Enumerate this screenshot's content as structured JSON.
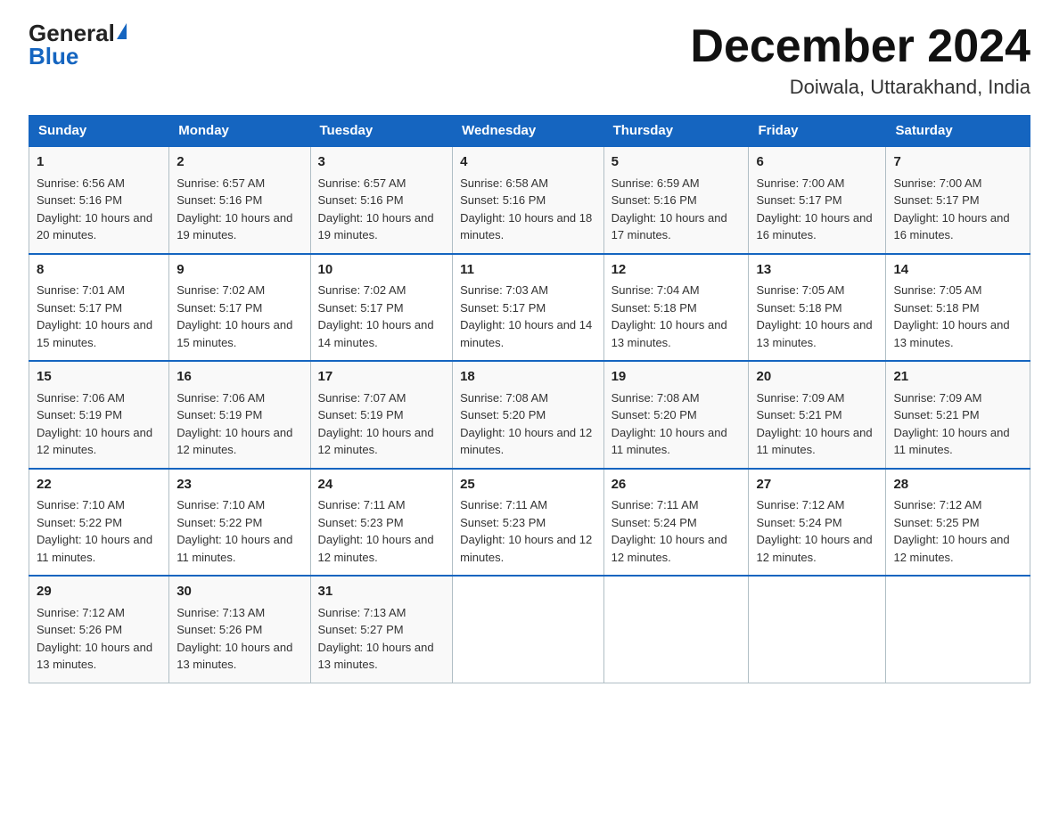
{
  "header": {
    "logo_general": "General",
    "logo_blue": "Blue",
    "month_title": "December 2024",
    "location": "Doiwala, Uttarakhand, India"
  },
  "days_of_week": [
    "Sunday",
    "Monday",
    "Tuesday",
    "Wednesday",
    "Thursday",
    "Friday",
    "Saturday"
  ],
  "weeks": [
    [
      {
        "day": "1",
        "sunrise": "6:56 AM",
        "sunset": "5:16 PM",
        "daylight": "10 hours and 20 minutes."
      },
      {
        "day": "2",
        "sunrise": "6:57 AM",
        "sunset": "5:16 PM",
        "daylight": "10 hours and 19 minutes."
      },
      {
        "day": "3",
        "sunrise": "6:57 AM",
        "sunset": "5:16 PM",
        "daylight": "10 hours and 19 minutes."
      },
      {
        "day": "4",
        "sunrise": "6:58 AM",
        "sunset": "5:16 PM",
        "daylight": "10 hours and 18 minutes."
      },
      {
        "day": "5",
        "sunrise": "6:59 AM",
        "sunset": "5:16 PM",
        "daylight": "10 hours and 17 minutes."
      },
      {
        "day": "6",
        "sunrise": "7:00 AM",
        "sunset": "5:17 PM",
        "daylight": "10 hours and 16 minutes."
      },
      {
        "day": "7",
        "sunrise": "7:00 AM",
        "sunset": "5:17 PM",
        "daylight": "10 hours and 16 minutes."
      }
    ],
    [
      {
        "day": "8",
        "sunrise": "7:01 AM",
        "sunset": "5:17 PM",
        "daylight": "10 hours and 15 minutes."
      },
      {
        "day": "9",
        "sunrise": "7:02 AM",
        "sunset": "5:17 PM",
        "daylight": "10 hours and 15 minutes."
      },
      {
        "day": "10",
        "sunrise": "7:02 AM",
        "sunset": "5:17 PM",
        "daylight": "10 hours and 14 minutes."
      },
      {
        "day": "11",
        "sunrise": "7:03 AM",
        "sunset": "5:17 PM",
        "daylight": "10 hours and 14 minutes."
      },
      {
        "day": "12",
        "sunrise": "7:04 AM",
        "sunset": "5:18 PM",
        "daylight": "10 hours and 13 minutes."
      },
      {
        "day": "13",
        "sunrise": "7:05 AM",
        "sunset": "5:18 PM",
        "daylight": "10 hours and 13 minutes."
      },
      {
        "day": "14",
        "sunrise": "7:05 AM",
        "sunset": "5:18 PM",
        "daylight": "10 hours and 13 minutes."
      }
    ],
    [
      {
        "day": "15",
        "sunrise": "7:06 AM",
        "sunset": "5:19 PM",
        "daylight": "10 hours and 12 minutes."
      },
      {
        "day": "16",
        "sunrise": "7:06 AM",
        "sunset": "5:19 PM",
        "daylight": "10 hours and 12 minutes."
      },
      {
        "day": "17",
        "sunrise": "7:07 AM",
        "sunset": "5:19 PM",
        "daylight": "10 hours and 12 minutes."
      },
      {
        "day": "18",
        "sunrise": "7:08 AM",
        "sunset": "5:20 PM",
        "daylight": "10 hours and 12 minutes."
      },
      {
        "day": "19",
        "sunrise": "7:08 AM",
        "sunset": "5:20 PM",
        "daylight": "10 hours and 11 minutes."
      },
      {
        "day": "20",
        "sunrise": "7:09 AM",
        "sunset": "5:21 PM",
        "daylight": "10 hours and 11 minutes."
      },
      {
        "day": "21",
        "sunrise": "7:09 AM",
        "sunset": "5:21 PM",
        "daylight": "10 hours and 11 minutes."
      }
    ],
    [
      {
        "day": "22",
        "sunrise": "7:10 AM",
        "sunset": "5:22 PM",
        "daylight": "10 hours and 11 minutes."
      },
      {
        "day": "23",
        "sunrise": "7:10 AM",
        "sunset": "5:22 PM",
        "daylight": "10 hours and 11 minutes."
      },
      {
        "day": "24",
        "sunrise": "7:11 AM",
        "sunset": "5:23 PM",
        "daylight": "10 hours and 12 minutes."
      },
      {
        "day": "25",
        "sunrise": "7:11 AM",
        "sunset": "5:23 PM",
        "daylight": "10 hours and 12 minutes."
      },
      {
        "day": "26",
        "sunrise": "7:11 AM",
        "sunset": "5:24 PM",
        "daylight": "10 hours and 12 minutes."
      },
      {
        "day": "27",
        "sunrise": "7:12 AM",
        "sunset": "5:24 PM",
        "daylight": "10 hours and 12 minutes."
      },
      {
        "day": "28",
        "sunrise": "7:12 AM",
        "sunset": "5:25 PM",
        "daylight": "10 hours and 12 minutes."
      }
    ],
    [
      {
        "day": "29",
        "sunrise": "7:12 AM",
        "sunset": "5:26 PM",
        "daylight": "10 hours and 13 minutes."
      },
      {
        "day": "30",
        "sunrise": "7:13 AM",
        "sunset": "5:26 PM",
        "daylight": "10 hours and 13 minutes."
      },
      {
        "day": "31",
        "sunrise": "7:13 AM",
        "sunset": "5:27 PM",
        "daylight": "10 hours and 13 minutes."
      },
      null,
      null,
      null,
      null
    ]
  ],
  "labels": {
    "sunrise_prefix": "Sunrise: ",
    "sunset_prefix": "Sunset: ",
    "daylight_prefix": "Daylight: "
  }
}
